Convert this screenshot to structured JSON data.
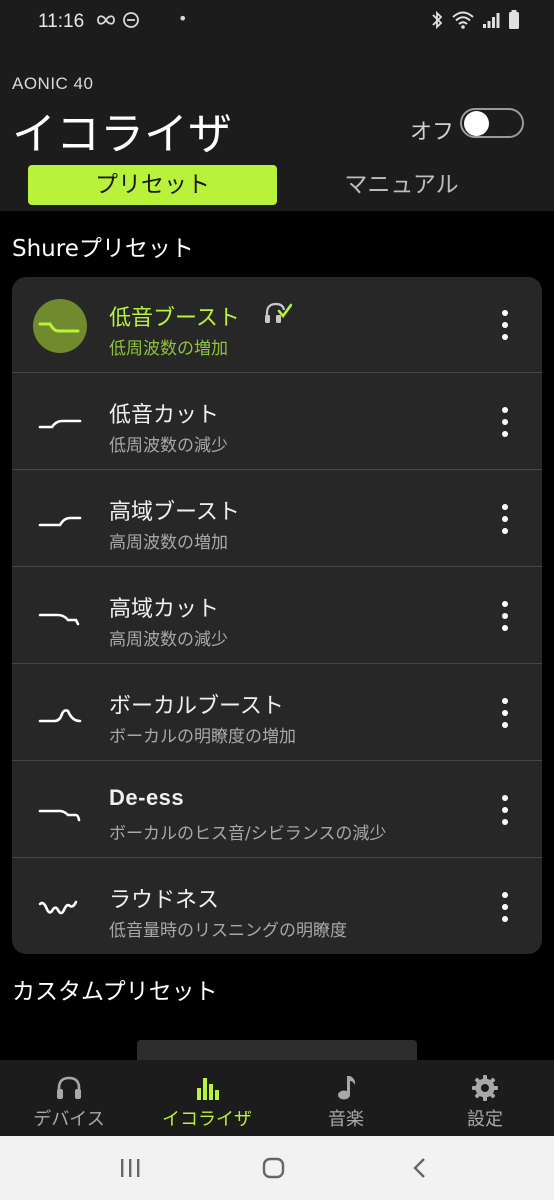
{
  "status_bar": {
    "time": "11:16",
    "left_icons": [
      "infinity-icon",
      "minus-circle-icon"
    ],
    "dot": "•",
    "right_icons": [
      "bluetooth-icon",
      "wifi-icon",
      "signal-icon",
      "battery-icon"
    ]
  },
  "header": {
    "device": "AONIC 40",
    "title": "イコライザ",
    "toggle_label": "オフ",
    "toggle_on": false
  },
  "tabs": [
    {
      "label": "プリセット",
      "active": true
    },
    {
      "label": "マニュアル",
      "active": false
    }
  ],
  "shure_section": {
    "title": "Shureプリセット",
    "presets": [
      {
        "name": "低音ブースト",
        "desc": "低周波数の増加",
        "active": true,
        "icon": "bass-boost-curve-icon",
        "badge": "headphone-check-icon"
      },
      {
        "name": "低音カット",
        "desc": "低周波数の減少",
        "active": false,
        "icon": "bass-cut-curve-icon"
      },
      {
        "name": "高域ブースト",
        "desc": "高周波数の増加",
        "active": false,
        "icon": "treble-boost-curve-icon"
      },
      {
        "name": "高域カット",
        "desc": "高周波数の減少",
        "active": false,
        "icon": "treble-cut-curve-icon"
      },
      {
        "name": "ボーカルブースト",
        "desc": "ボーカルの明瞭度の増加",
        "active": false,
        "icon": "vocal-boost-curve-icon"
      },
      {
        "name": "De-ess",
        "desc": "ボーカルのヒス音/シビランスの減少",
        "active": false,
        "icon": "de-ess-curve-icon"
      },
      {
        "name": "ラウドネス",
        "desc": "低音量時のリスニングの明瞭度",
        "active": false,
        "icon": "loudness-curve-icon"
      }
    ]
  },
  "custom_section": {
    "title": "カスタムプリセット"
  },
  "bottom_nav": [
    {
      "label": "デバイス",
      "icon": "headphones-icon",
      "active": false
    },
    {
      "label": "イコライザ",
      "icon": "equalizer-bars-icon",
      "active": true
    },
    {
      "label": "音楽",
      "icon": "music-note-icon",
      "active": false
    },
    {
      "label": "設定",
      "icon": "gear-icon",
      "active": false
    }
  ],
  "system_nav": [
    "recent-apps-icon",
    "home-icon",
    "back-icon"
  ],
  "colors": {
    "accent": "#b8f23a",
    "surface": "#1c1c1c",
    "card": "#272727",
    "background": "#000000"
  }
}
